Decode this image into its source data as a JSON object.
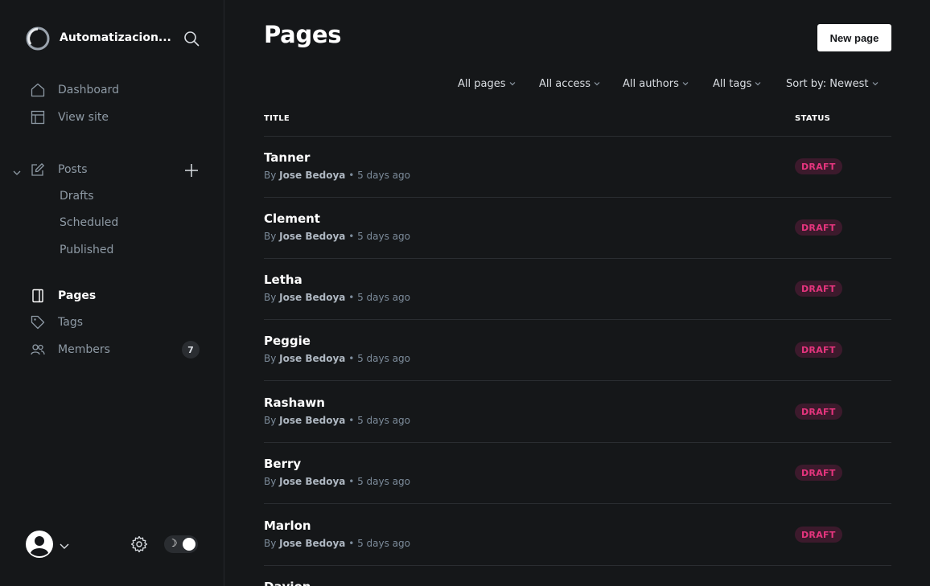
{
  "sidebar": {
    "site_name": "Automatizacion...",
    "nav": {
      "dashboard": "Dashboard",
      "view_site": "View site",
      "posts": "Posts",
      "drafts": "Drafts",
      "scheduled": "Scheduled",
      "published": "Published",
      "pages": "Pages",
      "tags": "Tags",
      "members": "Members",
      "members_count": "7"
    },
    "icons": [
      "search-icon",
      "home-icon",
      "layout-icon",
      "edit-icon",
      "plus-icon",
      "page-icon",
      "tag-icon",
      "members-icon",
      "gear-icon",
      "moon-icon"
    ]
  },
  "main": {
    "title": "Pages",
    "new_button": "New page",
    "filters": {
      "type": "All pages",
      "access": "All access",
      "authors": "All authors",
      "tags": "All tags",
      "sort": "Sort by: Newest"
    },
    "columns": {
      "title": "TITLE",
      "status": "STATUS"
    },
    "rows": [
      {
        "title": "Tanner",
        "by": "By",
        "author": "Jose Bedoya",
        "time": "• 5 days ago",
        "status": "DRAFT"
      },
      {
        "title": "Clement",
        "by": "By",
        "author": "Jose Bedoya",
        "time": "• 5 days ago",
        "status": "DRAFT"
      },
      {
        "title": "Letha",
        "by": "By",
        "author": "Jose Bedoya",
        "time": "• 5 days ago",
        "status": "DRAFT"
      },
      {
        "title": "Peggie",
        "by": "By",
        "author": "Jose Bedoya",
        "time": "• 5 days ago",
        "status": "DRAFT"
      },
      {
        "title": "Rashawn",
        "by": "By",
        "author": "Jose Bedoya",
        "time": "• 5 days ago",
        "status": "DRAFT"
      },
      {
        "title": "Berry",
        "by": "By",
        "author": "Jose Bedoya",
        "time": "• 5 days ago",
        "status": "DRAFT"
      },
      {
        "title": "Marlon",
        "by": "By",
        "author": "Jose Bedoya",
        "time": "• 5 days ago",
        "status": "DRAFT"
      },
      {
        "title": "Davion",
        "by": "",
        "author": "",
        "time": "",
        "status": ""
      }
    ]
  },
  "colors": {
    "background": "#151719",
    "draft_badge_bg": "#3c1a2c",
    "draft_badge_text": "#e6357e"
  }
}
